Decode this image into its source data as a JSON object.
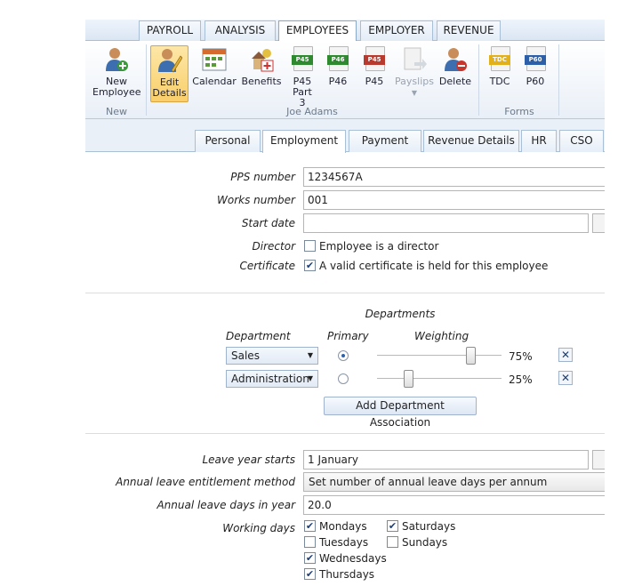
{
  "ribbon_tabs": [
    "PAYROLL",
    "ANALYSIS",
    "EMPLOYEES",
    "EMPLOYER",
    "REVENUE"
  ],
  "active_ribbon_tab": "EMPLOYEES",
  "ribbon": {
    "new_employee_line1": "New",
    "new_employee_line2": "Employee",
    "edit_details_line1": "Edit",
    "edit_details_line2": "Details",
    "calendar": "Calendar",
    "benefits": "Benefits",
    "p45": "P45",
    "p45_part3_line2": "Part 3",
    "p46": "P46",
    "p45b": "P45",
    "payslips": "Payslips",
    "delete": "Delete",
    "tdc": "TDC",
    "p60": "P60",
    "doc_tags": {
      "p45": "P45",
      "p46": "P46",
      "p45b": "P45",
      "tdc": "TDC",
      "p60": "P60"
    },
    "group_new": "New",
    "group_employee": "Joe Adams",
    "group_forms": "Forms"
  },
  "page_tabs": [
    "Personal",
    "Employment",
    "Payment",
    "Revenue Details",
    "HR",
    "CSO"
  ],
  "active_page_tab": "Employment",
  "form": {
    "pps_label": "PPS number",
    "pps_value": "1234567A",
    "works_label": "Works number",
    "works_value": "001",
    "start_label": "Start date",
    "start_value": "",
    "director_label": "Director",
    "director_text": "Employee is a director",
    "director_checked": false,
    "certificate_label": "Certificate",
    "certificate_text": "A valid certificate is held for this employee",
    "certificate_checked": true
  },
  "departments": {
    "title": "Departments",
    "col_department": "Department",
    "col_primary": "Primary",
    "col_weighting": "Weighting",
    "rows": [
      {
        "name": "Sales",
        "primary": true,
        "weighting": "75%",
        "weight_value": 75
      },
      {
        "name": "Administration",
        "primary": false,
        "weighting": "25%",
        "weight_value": 25
      }
    ],
    "add_button": "Add Department Association"
  },
  "leave": {
    "year_starts_label": "Leave year starts",
    "year_starts_value": "1 January",
    "method_label": "Annual leave entitlement method",
    "method_value": "Set number of annual leave days per annum",
    "days_label": "Annual leave days in year",
    "days_value": "20.0",
    "working_days_label": "Working days",
    "days": [
      {
        "name": "Mondays",
        "checked": true
      },
      {
        "name": "Tuesdays",
        "checked": false
      },
      {
        "name": "Wednesdays",
        "checked": true
      },
      {
        "name": "Thursdays",
        "checked": true
      },
      {
        "name": "Saturdays",
        "checked": true
      },
      {
        "name": "Sundays",
        "checked": false
      }
    ]
  },
  "colors": {
    "accent": "#2d62a8",
    "ribbon_selected": "#f9cf6a"
  },
  "check_mark": "✔",
  "remove_mark": "✕",
  "dropdown_arrow": "▼"
}
